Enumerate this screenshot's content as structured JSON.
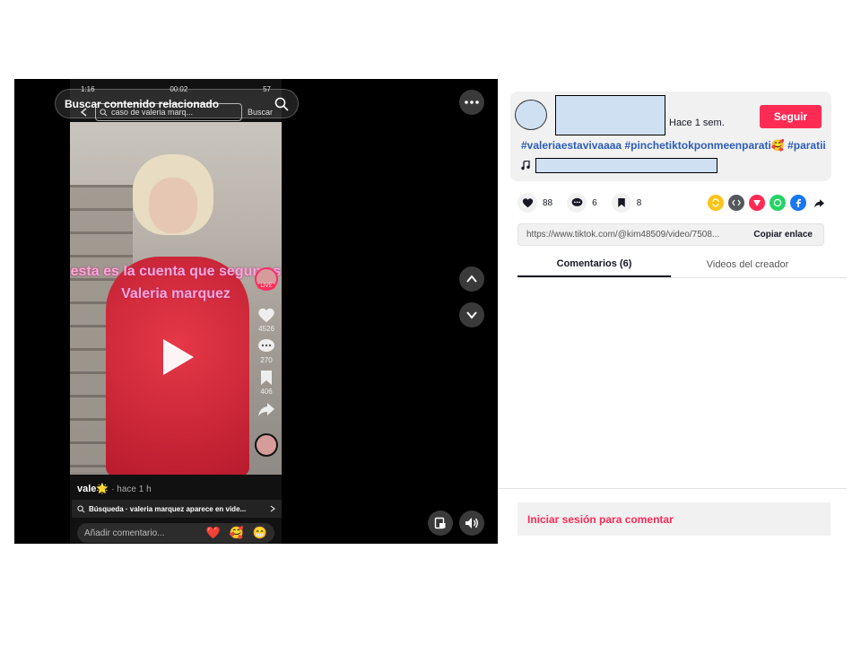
{
  "video": {
    "search_placeholder": "Buscar contenido relacionado",
    "phone": {
      "status_time": "1:16",
      "status_rec": "00:02",
      "status_battery": "57",
      "search_query": "caso de valeria marq...",
      "search_button": "Buscar",
      "overlay_line1": "esta es la cuenta que segun es",
      "overlay_line2": "Valeria marquez",
      "live_badge": "LIVE",
      "likes": "4526",
      "comments": "270",
      "saves": "406",
      "shares": "",
      "user": "vale",
      "user_emoji": "🌟",
      "user_time": "· hace 1 h",
      "related": "Búsqueda · valeria marquez aparece en vide...",
      "comment_placeholder": "Añadir comentario...",
      "emojis": [
        "❤️",
        "🥰",
        "😁"
      ]
    }
  },
  "post": {
    "time": "Hace 1 sem.",
    "follow_label": "Seguir",
    "tags": "#valeriaestavivaaaa #pinchetiktokponmeenparati🥰 #paratii",
    "likes": "88",
    "comments": "6",
    "saves": "8",
    "url": "https://www.tiktok.com/@kim48509/video/7508...",
    "copy_label": "Copiar enlace",
    "tabs": [
      "Comentarios (6)",
      "Videos del creador"
    ],
    "login_label": "Iniciar sesión para comentar"
  },
  "colors": {
    "accent": "#fe2c55",
    "tag": "#2b5db9",
    "redacted": "#cfe0f3"
  }
}
